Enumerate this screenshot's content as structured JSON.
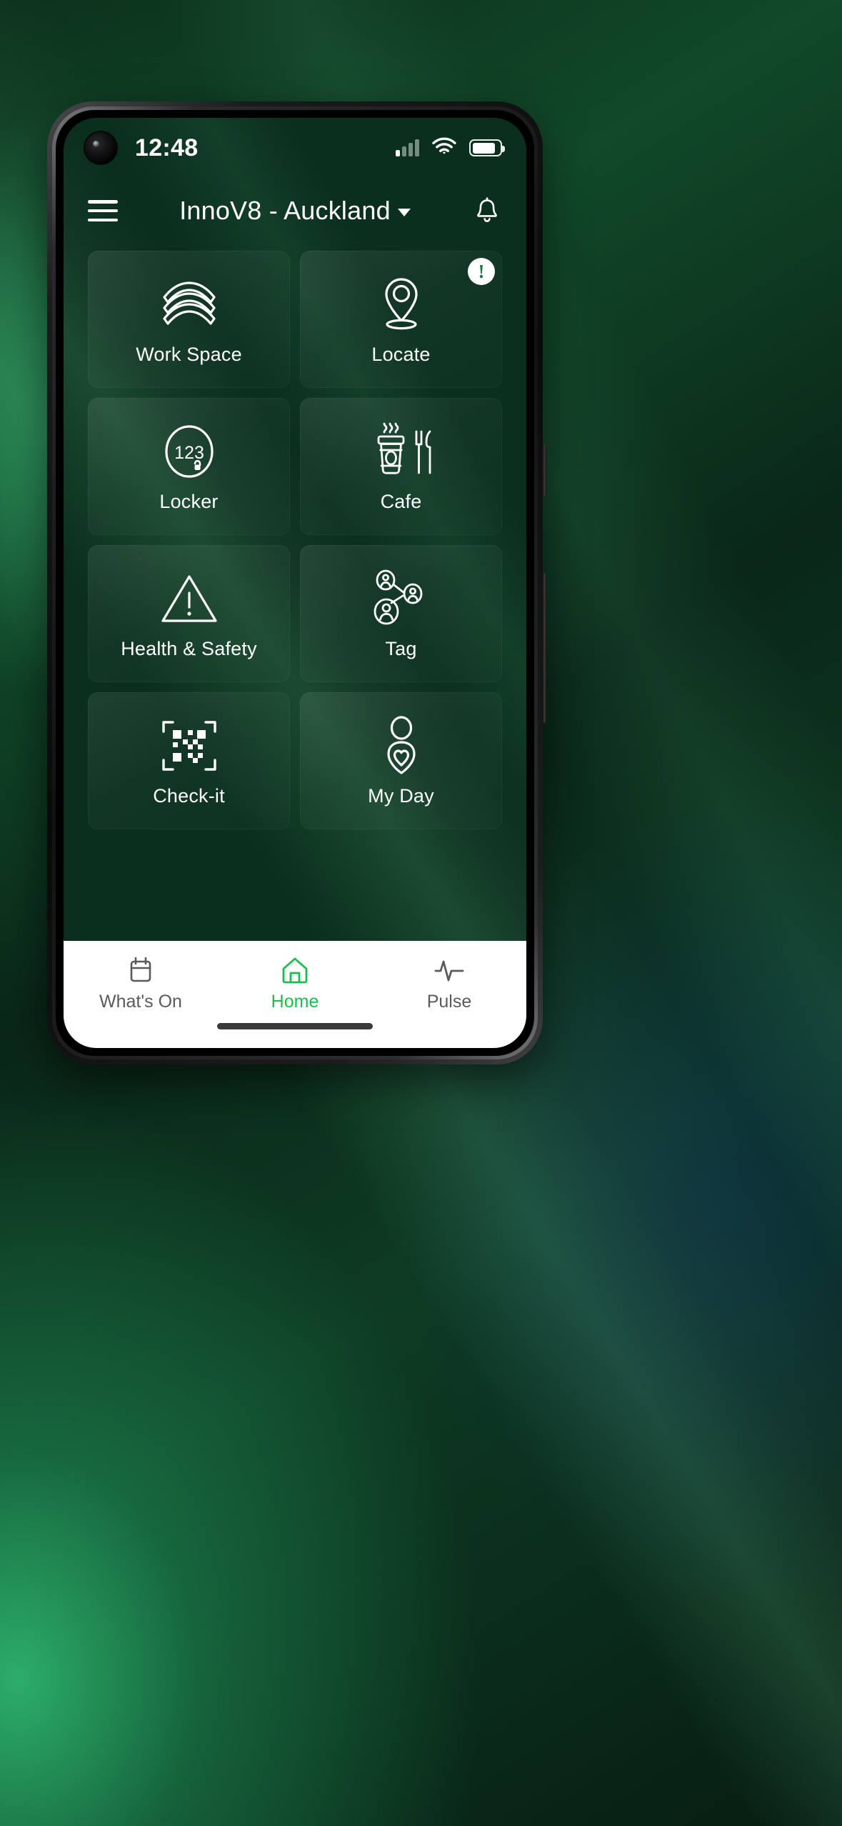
{
  "status_bar": {
    "time": "12:48",
    "signal_icon": "cellular-signal-icon",
    "signal_bars_total": 4,
    "signal_bars_active": 1,
    "wifi_icon": "wifi-icon",
    "battery_icon": "battery-icon",
    "battery_level_percent": 86
  },
  "header": {
    "menu_icon": "hamburger-menu-icon",
    "title": "InnoV8 - Auckland",
    "dropdown_icon": "chevron-down-icon",
    "notifications_icon": "bell-icon"
  },
  "tiles": [
    {
      "label": "Work Space",
      "icon": "layers-stack-icon",
      "badge": null
    },
    {
      "label": "Locate",
      "icon": "map-pin-icon",
      "badge": "!"
    },
    {
      "label": "Locker",
      "icon": "locker-dial-icon",
      "badge": null,
      "icon_text": "123"
    },
    {
      "label": "Cafe",
      "icon": "coffee-cutlery-icon",
      "badge": null
    },
    {
      "label": "Health & Safety",
      "icon": "warning-triangle-icon",
      "badge": null
    },
    {
      "label": "Tag",
      "icon": "people-network-icon",
      "badge": null
    },
    {
      "label": "Check-it",
      "icon": "qr-scan-icon",
      "badge": null
    },
    {
      "label": "My Day",
      "icon": "person-heart-icon",
      "badge": null
    }
  ],
  "bottom_nav": {
    "items": [
      {
        "label": "What's On",
        "icon": "calendar-icon",
        "active": false
      },
      {
        "label": "Home",
        "icon": "home-icon",
        "active": true
      },
      {
        "label": "Pulse",
        "icon": "heartbeat-icon",
        "active": false
      }
    ],
    "active_color": "#19bf4d",
    "inactive_color": "#5a5a5a"
  },
  "colors": {
    "screen_top_green": "#2aa05d",
    "screen_bottom_green": "#0a2f1d",
    "accent_green": "#19bf4d",
    "tile_text": "#ffffff",
    "badge_bg": "#ffffff",
    "badge_fg": "#1d7a45"
  }
}
